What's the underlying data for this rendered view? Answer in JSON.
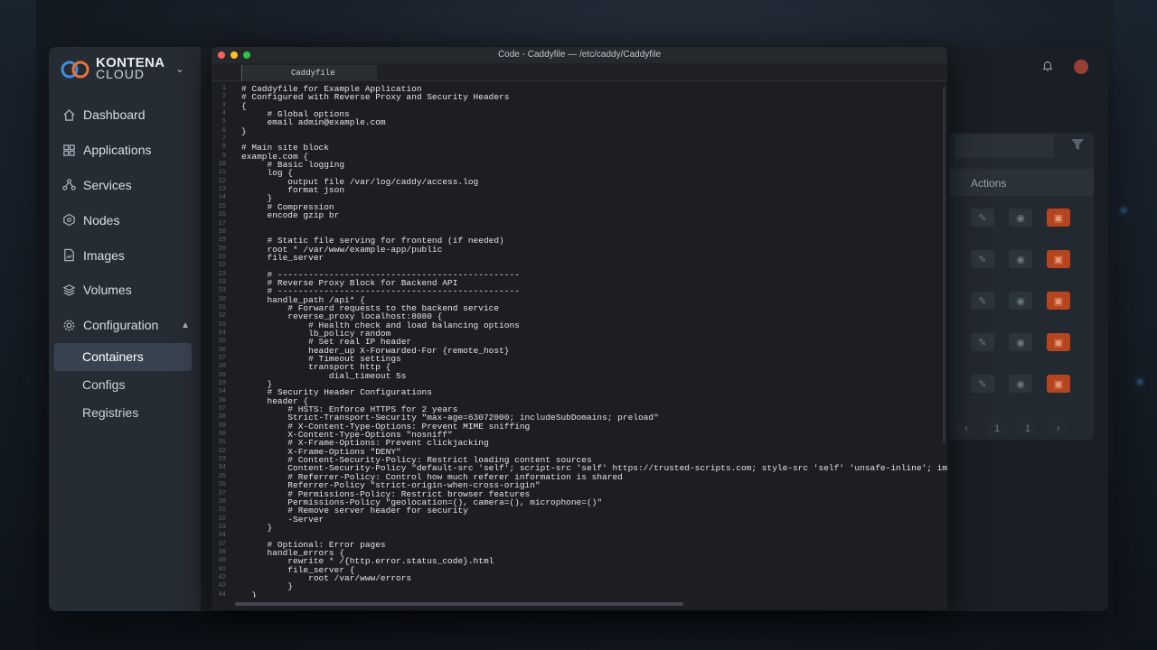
{
  "brand": {
    "line1": "KONTENA",
    "line2": "CLOUD"
  },
  "sidebar": {
    "items": [
      {
        "label": "Dashboard",
        "icon": "home-icon"
      },
      {
        "label": "Applications",
        "icon": "grid-icon"
      },
      {
        "label": "Services",
        "icon": "share-nodes-icon"
      },
      {
        "label": "Nodes",
        "icon": "hexagon-icon"
      },
      {
        "label": "Images",
        "icon": "file-image-icon"
      },
      {
        "label": "Volumes",
        "icon": "layers-icon"
      },
      {
        "label": "Configuration",
        "icon": "gear-icon"
      }
    ],
    "sub_items": [
      {
        "label": "Containers",
        "active": true
      },
      {
        "label": "Configs",
        "active": false
      },
      {
        "label": "Registries",
        "active": false
      }
    ]
  },
  "right_panel": {
    "actions_header": "Actions",
    "page_current": "1",
    "page_last": "1"
  },
  "editor": {
    "window_title": "Code - Caddyfile — /etc/caddy/Caddyfile",
    "tab_label": "Caddyfile",
    "lines": [
      {
        "n": "1",
        "t": "# Caddyfile for Example Application"
      },
      {
        "n": "2",
        "t": "# Configured with Reverse Proxy and Security Headers"
      },
      {
        "n": "3",
        "t": "{"
      },
      {
        "n": "4",
        "t": "     # Global options"
      },
      {
        "n": "5",
        "t": "     email admin@example.com"
      },
      {
        "n": "6",
        "t": "}"
      },
      {
        "n": "7",
        "t": ""
      },
      {
        "n": "8",
        "t": "# Main site block"
      },
      {
        "n": "9",
        "t": "example.com {"
      },
      {
        "n": "10",
        "t": "     # Basic logging"
      },
      {
        "n": "11",
        "t": "     log {"
      },
      {
        "n": "12",
        "t": "         output file /var/log/caddy/access.log"
      },
      {
        "n": "13",
        "t": "         format json"
      },
      {
        "n": "14",
        "t": "     }"
      },
      {
        "n": "15",
        "t": "     # Compression"
      },
      {
        "n": "16",
        "t": "     encode gzip br"
      },
      {
        "n": "17",
        "t": ""
      },
      {
        "n": "18",
        "t": ""
      },
      {
        "n": "19",
        "t": "     # Static file serving for frontend (if needed)"
      },
      {
        "n": "20",
        "t": "     root * /var/www/example-app/public"
      },
      {
        "n": "21",
        "t": "     file_server"
      },
      {
        "n": "22",
        "t": ""
      },
      {
        "n": "23",
        "t": "     # -----------------------------------------------"
      },
      {
        "n": "33",
        "t": "     # Reverse Proxy Block for Backend API"
      },
      {
        "n": "33",
        "t": "     # -----------------------------------------------"
      },
      {
        "n": "30",
        "t": "     handle_path /api* {"
      },
      {
        "n": "31",
        "t": "         # Forward requests to the backend service"
      },
      {
        "n": "32",
        "t": "         reverse_proxy localhost:8080 {"
      },
      {
        "n": "33",
        "t": "             # Health check and load balancing options"
      },
      {
        "n": "34",
        "t": "             lb_policy random"
      },
      {
        "n": "35",
        "t": "             # Set real IP header"
      },
      {
        "n": "36",
        "t": "             header_up X-Forwarded-For {remote_host}"
      },
      {
        "n": "37",
        "t": "             # Timeout settings"
      },
      {
        "n": "38",
        "t": "             transport http {"
      },
      {
        "n": "39",
        "t": "                 dial_timeout 5s"
      },
      {
        "n": "33",
        "t": "     }"
      },
      {
        "n": "34",
        "t": "     # Security Header Configurations"
      },
      {
        "n": "36",
        "t": "     header {"
      },
      {
        "n": "37",
        "t": "         # HSTS: Enforce HTTPS for 2 years"
      },
      {
        "n": "38",
        "t": "         Strict-Transport-Security \"max-age=63072000; includeSubDomains; preload\""
      },
      {
        "n": "39",
        "t": "         # X-Content-Type-Options: Prevent MIME sniffing"
      },
      {
        "n": "30",
        "t": "         X-Content-Type-Options \"nosniff\""
      },
      {
        "n": "31",
        "t": "         # X-Frame-Options: Prevent clickjacking"
      },
      {
        "n": "32",
        "t": "         X-Frame-Options \"DENY\""
      },
      {
        "n": "33",
        "t": "         # Content-Security-Policy: Restrict loading content sources"
      },
      {
        "n": "34",
        "t": "         Content-Security-Policy \"default-src 'self'; script-src 'self' https://trusted-scripts.com; style-src 'self' 'unsafe-inline'; img-src"
      },
      {
        "n": "35",
        "t": "         # Referrer-Policy: Control how much referer information is shared"
      },
      {
        "n": "36",
        "t": "         Referrer-Policy \"strict-origin-when-cross-origin\""
      },
      {
        "n": "37",
        "t": "         # Permissions-Policy: Restrict browser features"
      },
      {
        "n": "30",
        "t": "         Permissions-Policy \"geolocation=(), camera=(), microphone=()\""
      },
      {
        "n": "31",
        "t": "         # Remove server header for security"
      },
      {
        "n": "32",
        "t": "         -Server"
      },
      {
        "n": "33",
        "t": "     }"
      },
      {
        "n": "34",
        "t": ""
      },
      {
        "n": "37",
        "t": "     # Optional: Error pages"
      },
      {
        "n": "38",
        "t": "     handle_errors {"
      },
      {
        "n": "40",
        "t": "         rewrite * /{http.error.status_code}.html"
      },
      {
        "n": "41",
        "t": "         file_server {"
      },
      {
        "n": "42",
        "t": "             root /var/www/errors"
      },
      {
        "n": "43",
        "t": "         }"
      },
      {
        "n": "44",
        "t": "  }"
      },
      {
        "n": "45",
        "t": ""
      }
    ]
  },
  "colors": {
    "sidebar_bg": "#262c33",
    "active_item_bg": "#39434f",
    "delete_accent": "#b4451f",
    "brand_blue": "#3d8fe0",
    "brand_orange": "#e8743a"
  }
}
